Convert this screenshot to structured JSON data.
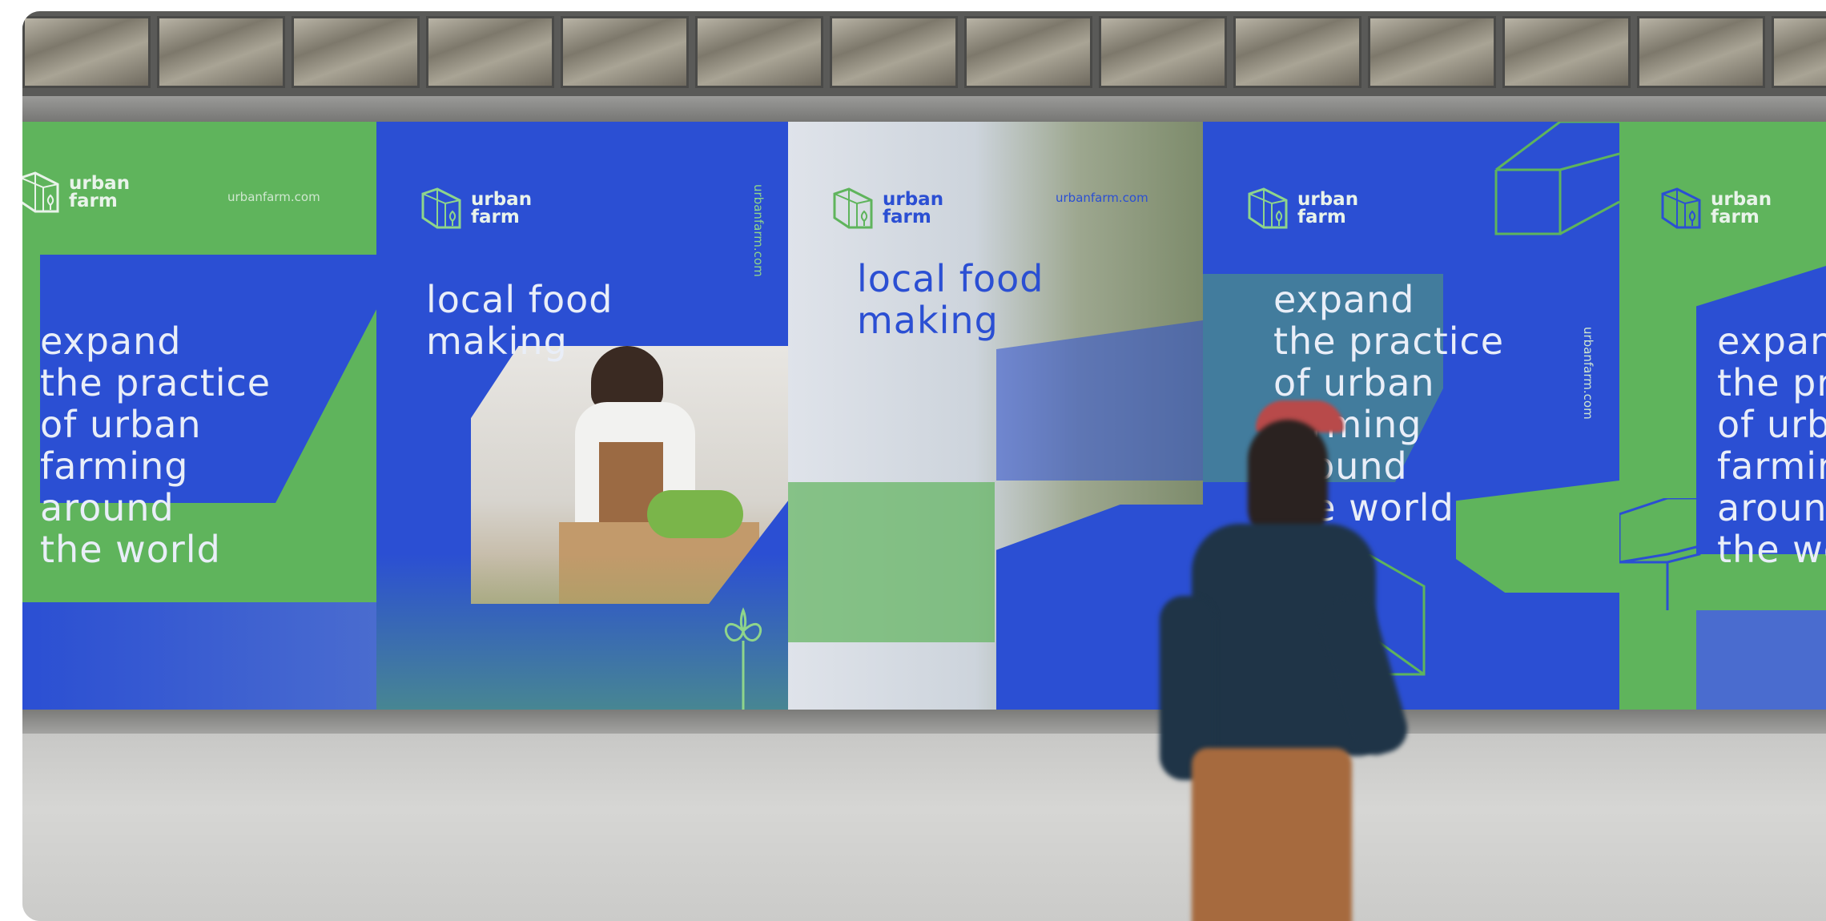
{
  "scene": {
    "description": "",
    "colors": {
      "blue": "#2b4fd3",
      "green": "#5fb45c",
      "wall": "#d0d0ce"
    }
  },
  "posters": [
    {
      "logo": "urban\nfarm",
      "url": "urbanfarm.com",
      "headline": "expand\nthe practice\nof urban\nfarming\naround\nthe world"
    },
    {
      "logo": "urban\nfarm",
      "url": "urbanfarm.com",
      "headline": "local food\nmaking"
    },
    {
      "logo": "urban\nfarm",
      "url": "urbanfarm.com",
      "headline": "local food\nmaking"
    },
    {
      "logo": "urban\nfarm",
      "url": "urbanfarm.com",
      "headline": "expand\nthe practice\nof urban\nfarming\naround\nthe world"
    },
    {
      "logo": "urban\nfarm",
      "url": "",
      "headline": "expand\nthe pra\nof urba\nfarming\naround\nthe wo"
    }
  ]
}
